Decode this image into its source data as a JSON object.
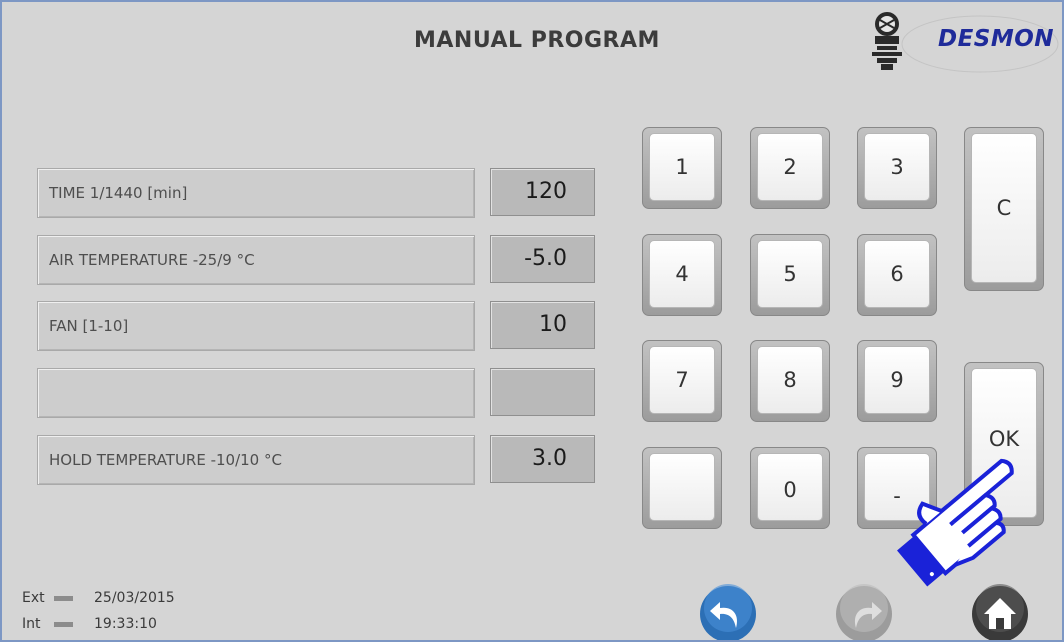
{
  "header": {
    "title": "MANUAL PROGRAM",
    "brand": "DESMON"
  },
  "params": [
    {
      "label": "TIME 1/1440 [min]",
      "value": "120"
    },
    {
      "label": "AIR TEMPERATURE -25/9 °C",
      "value": "-5.0"
    },
    {
      "label": "FAN [1-10]",
      "value": "10"
    },
    {
      "label": "",
      "value": ""
    },
    {
      "label": "HOLD TEMPERATURE -10/10 °C",
      "value": "3.0"
    }
  ],
  "keypad": {
    "k1": "1",
    "k2": "2",
    "k3": "3",
    "k4": "4",
    "k5": "5",
    "k6": "6",
    "k7": "7",
    "k8": "8",
    "k9": "9",
    "k0": "0",
    "minus": "-",
    "blank": "",
    "clear": "C",
    "ok": "OK"
  },
  "status": {
    "ext_label": "Ext",
    "date": "25/03/2015",
    "int_label": "Int",
    "time": "19:33:10"
  },
  "icons": {
    "back": "back-arrow-icon",
    "forward": "forward-arrow-icon",
    "home": "home-icon",
    "pointer": "pointing-hand-icon"
  },
  "colors": {
    "background": "#d5d5d5",
    "brand": "#1f2b9a",
    "nav_active": "#2c6fb5",
    "pointer": "#1a22d8"
  }
}
